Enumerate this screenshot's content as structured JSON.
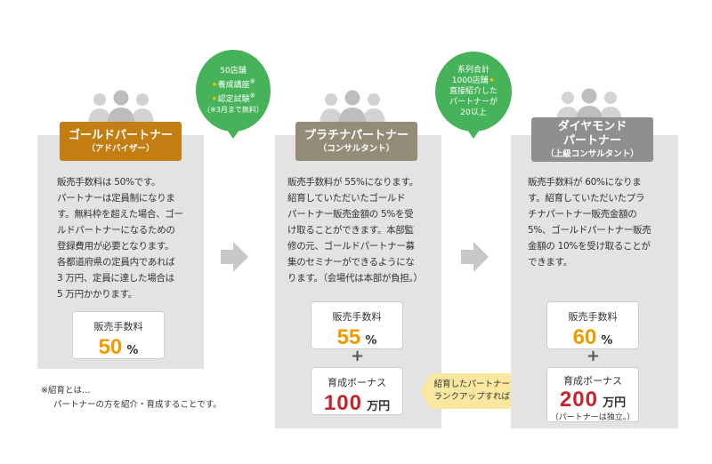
{
  "colors": {
    "gold": "#c47d10",
    "platinum": "#928c79",
    "diamond": "#8f8f8f",
    "bubble": "#46b35a",
    "orange": "#ee9c00",
    "red": "#c4262e"
  },
  "bubble1": {
    "line1": "50店舗",
    "line2": "養成講座",
    "line2_mark": "※",
    "line3": "認定試験",
    "line3_mark": "※",
    "line4": "（※3月まで無料）"
  },
  "bubble2": {
    "line1": "系列合計",
    "line2": "1000店舗",
    "line3": "直接紹介した",
    "line4": "パートナーが",
    "line5": "20以上"
  },
  "gold": {
    "title": "ゴールドパートナー",
    "subtitle": "（アドバイザー）",
    "desc": [
      "販売手数料は 50%です。",
      "パートナーは定員制になりま",
      "す。無料枠を超えた場合、ゴー",
      "ルドパートナーになるための",
      "登録費用が必要となります。",
      "各都道府県の定員内であれば",
      "3 万円、定員に達した場合は",
      "5 万円かかります。"
    ],
    "fee_label": "販売手数料",
    "fee_value": "50",
    "fee_unit": "%"
  },
  "platinum": {
    "title": "プラチナパートナー",
    "subtitle": "（コンサルタント）",
    "desc": [
      "販売手数料が 55%になります。",
      "紹育していただいたゴールド",
      "パートナー販売金額の 5%を受",
      "け取ることができます。本部監",
      "修の元、ゴールドパートナー募",
      "集のセミナーができるようにな",
      "ります。（会場代は本部が負担。）"
    ],
    "fee_label": "販売手数料",
    "fee_value": "55",
    "fee_unit": "%",
    "bonus_label": "育成ボーナス",
    "bonus_value": "100",
    "bonus_unit": "万円"
  },
  "diamond": {
    "title1": "ダイヤモンド",
    "title2": "パートナー",
    "subtitle": "（上級コンサルタント）",
    "desc": [
      "販売手数料が 60%になりま",
      "す。紹育していただいたプラ",
      "チナパートナー販売金額の",
      "5%、ゴールドパートナー販売",
      "金額の 10%を受け取ることが",
      "できます。"
    ],
    "fee_label": "販売手数料",
    "fee_value": "60",
    "fee_unit": "%",
    "bonus_label": "育成ボーナス",
    "bonus_value": "200",
    "bonus_unit": "万円",
    "bonus_note": "（パートナーは独立。）"
  },
  "plus": "+",
  "callout": {
    "line1": "紹育したパートナーが",
    "line2": "ランクアップすれば…"
  },
  "note": {
    "line1": "※紹育とは…",
    "line2": "パートナーの方を紹介・育成することです。"
  },
  "icons": {
    "people": "people-group-icon",
    "arrow": "right-arrow-icon"
  }
}
